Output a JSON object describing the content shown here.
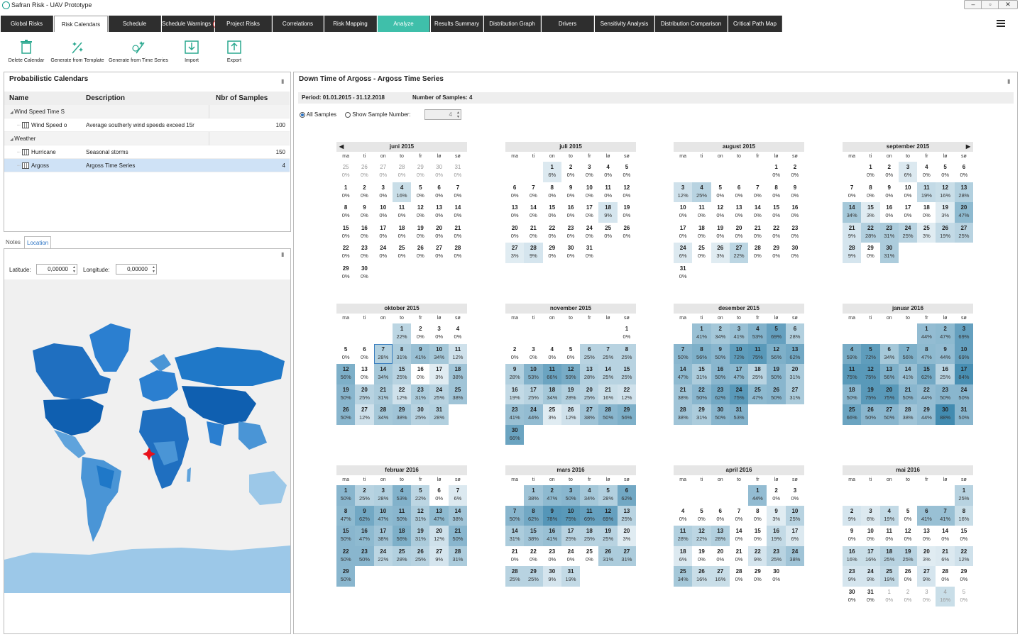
{
  "window": {
    "title": "Safran Risk - UAV Prototype",
    "min": "–",
    "max": "▫",
    "close": "✕"
  },
  "tabs": [
    {
      "label": "Global Risks",
      "state": "normal"
    },
    {
      "label": "Risk Calendars",
      "state": "active"
    },
    {
      "label": "Schedule",
      "state": "normal"
    },
    {
      "label": "Schedule Warnings",
      "state": "normal",
      "badge": "2"
    },
    {
      "label": "Project Risks",
      "state": "normal"
    },
    {
      "label": "Correlations",
      "state": "normal"
    },
    {
      "label": "Risk Mapping",
      "state": "normal"
    },
    {
      "label": "Analyze",
      "state": "analyze"
    },
    {
      "label": "Results Summary",
      "state": "normal"
    },
    {
      "label": "Distribution Graph",
      "state": "normal"
    },
    {
      "label": "Drivers",
      "state": "normal"
    },
    {
      "label": "Sensitivity Analysis",
      "state": "normal"
    },
    {
      "label": "Distribution Comparison",
      "state": "normal"
    },
    {
      "label": "Critical Path Map",
      "state": "normal"
    }
  ],
  "toolbar": {
    "delete": "Delete Calendar",
    "gen_template": "Generate from Template",
    "gen_timeseries": "Generate from Time Series",
    "import": "Import",
    "export": "Export"
  },
  "left": {
    "title": "Probabilistic Calendars",
    "columns": {
      "name": "Name",
      "description": "Description",
      "samples": "Nbr of Samples"
    },
    "rows": [
      {
        "name": "Wind Speed Time S",
        "description": "",
        "samples": "",
        "type": "group"
      },
      {
        "name": "Wind Speed o",
        "description": "Average southerly wind speeds exceed 15r",
        "samples": "100",
        "type": "item"
      },
      {
        "name": "Weather",
        "description": "",
        "samples": "",
        "type": "group"
      },
      {
        "name": "Hurricane",
        "description": "Seasonal storms",
        "samples": "150",
        "type": "item"
      },
      {
        "name": "Argoss",
        "description": "Argoss Time Series",
        "samples": "4",
        "type": "item",
        "selected": true
      }
    ],
    "tabs": {
      "notes": "Notes",
      "location": "Location"
    },
    "latitude_label": "Latitude:",
    "latitude": "0,00000",
    "longitude_label": "Longitude:",
    "longitude": "0,00000"
  },
  "right": {
    "title": "Down Time of Argoss - Argoss Time Series",
    "period": "Period: 01.01.2015 - 31.12.2018",
    "samples": "Number of Samples: 4",
    "all_samples": "All Samples",
    "show_sample": "Show Sample Number:",
    "sample_number": "4"
  },
  "calendar": {
    "dows": [
      "ma",
      "ti",
      "on",
      "to",
      "fr",
      "lø",
      "sø"
    ],
    "months": [
      {
        "name": "juni 2015",
        "offset": 0,
        "days": 30,
        "lead": [
          25,
          26,
          27,
          28,
          29,
          30,
          31
        ],
        "pct": [
          0,
          0,
          0,
          16,
          0,
          0,
          0,
          0,
          0,
          0,
          0,
          0,
          0,
          0,
          0,
          0,
          0,
          0,
          0,
          0,
          0,
          0,
          0,
          0,
          0,
          0,
          0,
          0,
          0,
          0
        ],
        "prev": true
      },
      {
        "name": "juli 2015",
        "offset": 2,
        "days": 31,
        "pct": [
          6,
          0,
          0,
          0,
          0,
          0,
          0,
          0,
          0,
          0,
          0,
          0,
          0,
          0,
          0,
          0,
          0,
          9,
          0,
          0,
          0,
          0,
          0,
          0,
          0,
          0,
          3,
          9,
          0,
          0,
          0
        ]
      },
      {
        "name": "august 2015",
        "offset": 5,
        "days": 31,
        "pct": [
          0,
          0,
          12,
          25,
          0,
          0,
          0,
          0,
          0,
          0,
          0,
          0,
          0,
          0,
          0,
          0,
          0,
          0,
          0,
          0,
          0,
          0,
          0,
          6,
          0,
          3,
          22,
          0,
          0,
          0,
          0
        ]
      },
      {
        "name": "september 2015",
        "offset": 1,
        "days": 30,
        "pct": [
          0,
          0,
          6,
          0,
          0,
          0,
          0,
          0,
          0,
          0,
          19,
          16,
          28,
          34,
          3,
          0,
          0,
          0,
          3,
          47,
          9,
          28,
          31,
          25,
          3,
          19,
          25,
          9,
          0,
          31
        ],
        "next": true
      },
      {
        "name": "oktober 2015",
        "offset": 3,
        "days": 31,
        "pct": [
          22,
          0,
          0,
          0,
          0,
          0,
          28,
          31,
          41,
          34,
          12,
          56,
          0,
          34,
          25,
          0,
          3,
          38,
          50,
          25,
          31,
          12,
          31,
          25,
          38,
          50,
          12,
          34,
          38,
          25,
          28
        ],
        "today": 7
      },
      {
        "name": "november 2015",
        "offset": 6,
        "days": 30,
        "pct": [
          0,
          0,
          0,
          0,
          0,
          25,
          25,
          25,
          28,
          53,
          66,
          59,
          28,
          25,
          25,
          19,
          25,
          34,
          28,
          25,
          16,
          12,
          41,
          44,
          3,
          12,
          38,
          50,
          56,
          66
        ]
      },
      {
        "name": "desember 2015",
        "offset": 1,
        "days": 31,
        "pct": [
          41,
          34,
          41,
          53,
          69,
          28,
          50,
          56,
          50,
          72,
          75,
          56,
          62,
          47,
          31,
          50,
          47,
          25,
          50,
          31,
          38,
          50,
          62,
          75,
          47,
          50,
          31,
          38,
          31,
          50,
          53
        ]
      },
      {
        "name": "januar 2016",
        "offset": 4,
        "days": 31,
        "pct": [
          44,
          47,
          69,
          59,
          72,
          34,
          56,
          47,
          44,
          69,
          75,
          75,
          56,
          41,
          62,
          25,
          84,
          50,
          75,
          75,
          50,
          44,
          50,
          50,
          66,
          50,
          50,
          38,
          44,
          88,
          50
        ]
      },
      {
        "name": "februar 2016",
        "offset": 0,
        "days": 29,
        "pct": [
          50,
          25,
          28,
          53,
          22,
          0,
          6,
          47,
          62,
          47,
          50,
          31,
          47,
          38,
          50,
          47,
          38,
          56,
          31,
          12,
          50,
          50,
          50,
          22,
          28,
          25,
          9,
          31,
          50
        ]
      },
      {
        "name": "mars 2016",
        "offset": 1,
        "days": 31,
        "pct": [
          38,
          47,
          50,
          34,
          28,
          62,
          50,
          62,
          78,
          75,
          69,
          69,
          25,
          31,
          38,
          41,
          25,
          25,
          25,
          3,
          0,
          0,
          0,
          0,
          0,
          31,
          31,
          25,
          25,
          9,
          19
        ]
      },
      {
        "name": "april 2016",
        "offset": 4,
        "days": 30,
        "pct": [
          44,
          0,
          0,
          0,
          0,
          0,
          0,
          0,
          3,
          25,
          28,
          22,
          28,
          0,
          0,
          19,
          6,
          6,
          0,
          0,
          0,
          9,
          25,
          38,
          34,
          16,
          16,
          0,
          0,
          0
        ]
      },
      {
        "name": "mai 2016",
        "offset": 6,
        "days": 31,
        "pct": [
          25,
          9,
          6,
          19,
          0,
          41,
          41,
          16,
          0,
          0,
          0,
          0,
          0,
          0,
          0,
          16,
          16,
          25,
          25,
          3,
          6,
          12,
          9,
          9,
          19,
          0,
          9,
          0,
          0,
          0,
          0
        ],
        "trail": [
          1,
          2,
          3,
          4,
          5
        ],
        "trailpct": [
          0,
          0,
          0,
          16,
          0
        ]
      }
    ]
  },
  "colors": {
    "tabbar": "#2e2e2e",
    "analyze": "#3fbfaa",
    "selected": "#cfe2f6",
    "heat": "#2f7fa8",
    "map_dark": "#1f78c8",
    "map_light": "#9cc8e8"
  }
}
